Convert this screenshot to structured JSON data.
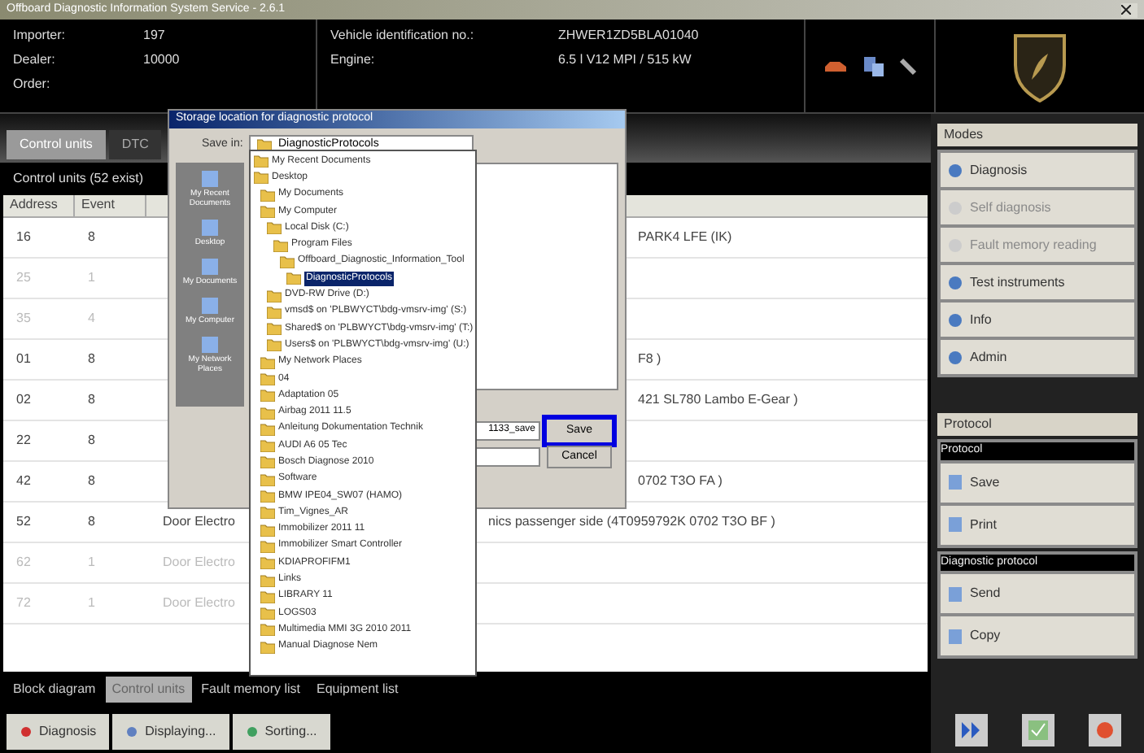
{
  "window": {
    "title": "Offboard Diagnostic Information System Service - 2.6.1"
  },
  "header": {
    "fields": [
      {
        "label": "Importer:",
        "value": "197"
      },
      {
        "label": "Dealer:",
        "value": "10000"
      },
      {
        "label": "Order:"
      }
    ],
    "vehicle": [
      {
        "label": "Vehicle identification no.:",
        "value": "ZHWER1ZD5BLA01040"
      },
      {
        "label": "Engine:",
        "value": "6.5 l V12 MPI / 515 kW"
      }
    ]
  },
  "tabs": [
    {
      "label": "Control units",
      "selected": true
    },
    {
      "label": "DTC",
      "selected": false
    }
  ],
  "table_caption": "Control units (52 exist)",
  "table": {
    "columns": [
      "Address",
      "Event"
    ],
    "rows": [
      {
        "address": "16",
        "event": "8",
        "text": "PARK4 LFE (IK)",
        "disabled": false
      },
      {
        "address": "25",
        "event": "1",
        "disabled": true
      },
      {
        "address": "35",
        "event": "4",
        "disabled": true
      },
      {
        "address": "01",
        "event": "8",
        "text": "F8 )",
        "disabled": false
      },
      {
        "address": "02",
        "event": "8",
        "text": "421  SL780 Lambo E-Gear )",
        "disabled": false
      },
      {
        "address": "22",
        "event": "8",
        "disabled": false
      },
      {
        "address": "42",
        "event": "8",
        "text": "0702  T3O FA  )",
        "disabled": false
      },
      {
        "address": "52",
        "event": "8",
        "text_left": "Door Electro",
        "text": "nics passenger side (4T0959792K  0702  T3O BF  )",
        "disabled": false
      },
      {
        "address": "62",
        "event": "1",
        "text_left": "Door Electro",
        "disabled": true
      },
      {
        "address": "72",
        "event": "1",
        "text_left": "Door Electro",
        "disabled": true
      }
    ]
  },
  "bottom_tabs": [
    {
      "label": "Block diagram",
      "selected": false
    },
    {
      "label": "Control units",
      "selected": true
    },
    {
      "label": "Fault memory list",
      "selected": false
    },
    {
      "label": "Equipment list",
      "selected": false
    }
  ],
  "bottom_buttons": [
    "Diagnosis",
    "Displaying...",
    "Sorting..."
  ],
  "modes": {
    "title": "Modes",
    "items": [
      {
        "label": "Diagnosis",
        "disabled": false
      },
      {
        "label": "Self diagnosis",
        "disabled": true
      },
      {
        "label": "Fault memory reading",
        "disabled": true
      },
      {
        "label": "Test instruments",
        "disabled": false
      },
      {
        "label": "Info",
        "disabled": false
      },
      {
        "label": "Admin",
        "disabled": false
      }
    ]
  },
  "protocol": {
    "title": "Protocol",
    "groups": [
      {
        "title": "Protocol",
        "items": [
          "Save",
          "Print"
        ]
      },
      {
        "title": "Diagnostic protocol",
        "items": [
          "Send",
          "Copy"
        ]
      }
    ]
  },
  "dialog": {
    "title": "Storage location for diagnostic protocol",
    "save_in_label": "Save in:",
    "save_in": "DiagnosticProtocols",
    "places": [
      "My Recent Documents",
      "Desktop",
      "My Documents",
      "My Computer",
      "My Network Places"
    ],
    "file_name": "1133_save",
    "buttons": [
      {
        "label": "Save",
        "highlighted": true
      },
      {
        "label": "Cancel",
        "highlighted": false
      }
    ],
    "dropdown": [
      {
        "label": "My Recent Documents",
        "selected": false
      },
      {
        "label": "Desktop",
        "selected": false,
        "children": [
          {
            "label": "My Documents",
            "selected": false
          },
          {
            "label": "My Computer",
            "selected": false,
            "children": [
              {
                "label": "Local Disk (C:)",
                "selected": false,
                "children": [
                  {
                    "label": "Program Files",
                    "selected": false,
                    "children": [
                      {
                        "label": "Offboard_Diagnostic_Information_Tool",
                        "selected": false,
                        "children": [
                          {
                            "label": "DiagnosticProtocols",
                            "selected": true
                          }
                        ]
                      }
                    ]
                  }
                ]
              },
              {
                "label": "DVD-RW Drive (D:)",
                "selected": false
              },
              {
                "label": "vmsd$ on 'PLBWYCT\\bdg-vmsrv-img' (S:)",
                "selected": false
              },
              {
                "label": "Shared$ on 'PLBWYCT\\bdg-vmsrv-img' (T:)",
                "selected": false
              },
              {
                "label": "Users$ on 'PLBWYCT\\bdg-vmsrv-img' (U:)",
                "selected": false
              }
            ]
          },
          {
            "label": "My Network Places",
            "selected": false
          },
          {
            "label": "04",
            "selected": false
          },
          {
            "label": "Adaptation 05",
            "selected": false
          },
          {
            "label": "Airbag 2011 11.5",
            "selected": false
          },
          {
            "label": "Anleitung Dokumentation Technik",
            "selected": false
          },
          {
            "label": "AUDI A6 05 Tec",
            "selected": false
          },
          {
            "label": "Bosch Diagnose 2010",
            "selected": false
          },
          {
            "label": "Software",
            "selected": false
          },
          {
            "label": "BMW IPE04_SW07 (HAMO)",
            "selected": false
          },
          {
            "label": "Tim_Vignes_AR",
            "selected": false
          },
          {
            "label": "Immobilizer 2011 11",
            "selected": false
          },
          {
            "label": "Immobilizer Smart Controller",
            "selected": false
          },
          {
            "label": "KDIAPROFIFM1",
            "selected": false
          },
          {
            "label": "Links",
            "selected": false
          },
          {
            "label": "LIBRARY 11",
            "selected": false
          },
          {
            "label": "LOGS03",
            "selected": false
          },
          {
            "label": "Multimedia MMI 3G 2010 2011",
            "selected": false
          },
          {
            "label": "Manual Diagnose Nem",
            "selected": false
          }
        ]
      }
    ]
  }
}
